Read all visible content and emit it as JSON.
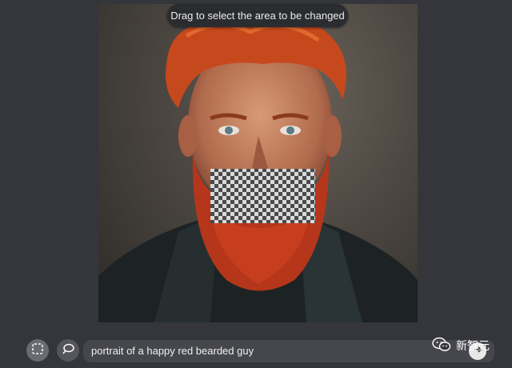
{
  "tooltip": {
    "text": "Drag to select the area to be changed"
  },
  "toolbar": {
    "select_tool_icon": "dashed-square-select-icon",
    "chat_tool_icon": "speech-bubble-icon"
  },
  "prompt": {
    "value": "portrait of a happy red bearded guy"
  },
  "submit": {
    "icon": "arrow-right-icon"
  },
  "watermark": {
    "text": "新智元",
    "icon": "wechat-logo-icon"
  },
  "colors": {
    "background": "#35363b",
    "input": "#46474c",
    "tooltip": "#2b2c30"
  }
}
